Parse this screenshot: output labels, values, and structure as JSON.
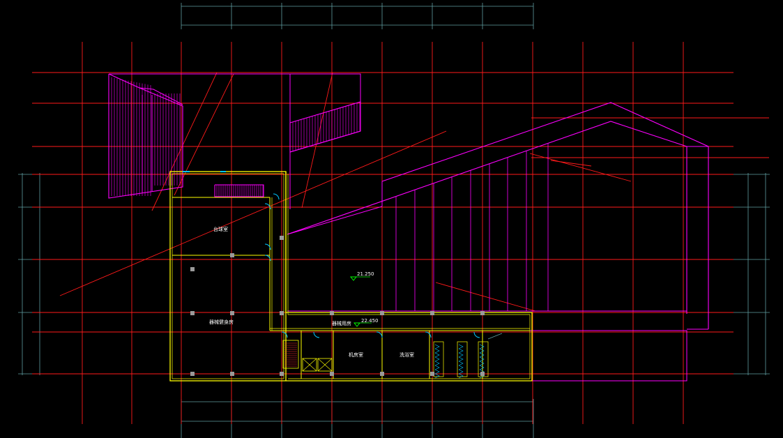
{
  "drawing": {
    "colors": {
      "background": "#000000",
      "grid": "#ff1a1a",
      "walls": "#ffff00",
      "magenta": "#ff00ff",
      "dims": "#5f9ea0",
      "doors": "#00c8ff",
      "columns": "#9a9a9a",
      "marker": "#00ff00"
    },
    "rooms": {
      "billiards": "台球室",
      "fitness": "器械健身房",
      "storage": "器械用房",
      "machine": "机房室",
      "restroom": "洗浴室"
    },
    "levels": {
      "main": "21.250",
      "corridor": "22.450"
    }
  }
}
